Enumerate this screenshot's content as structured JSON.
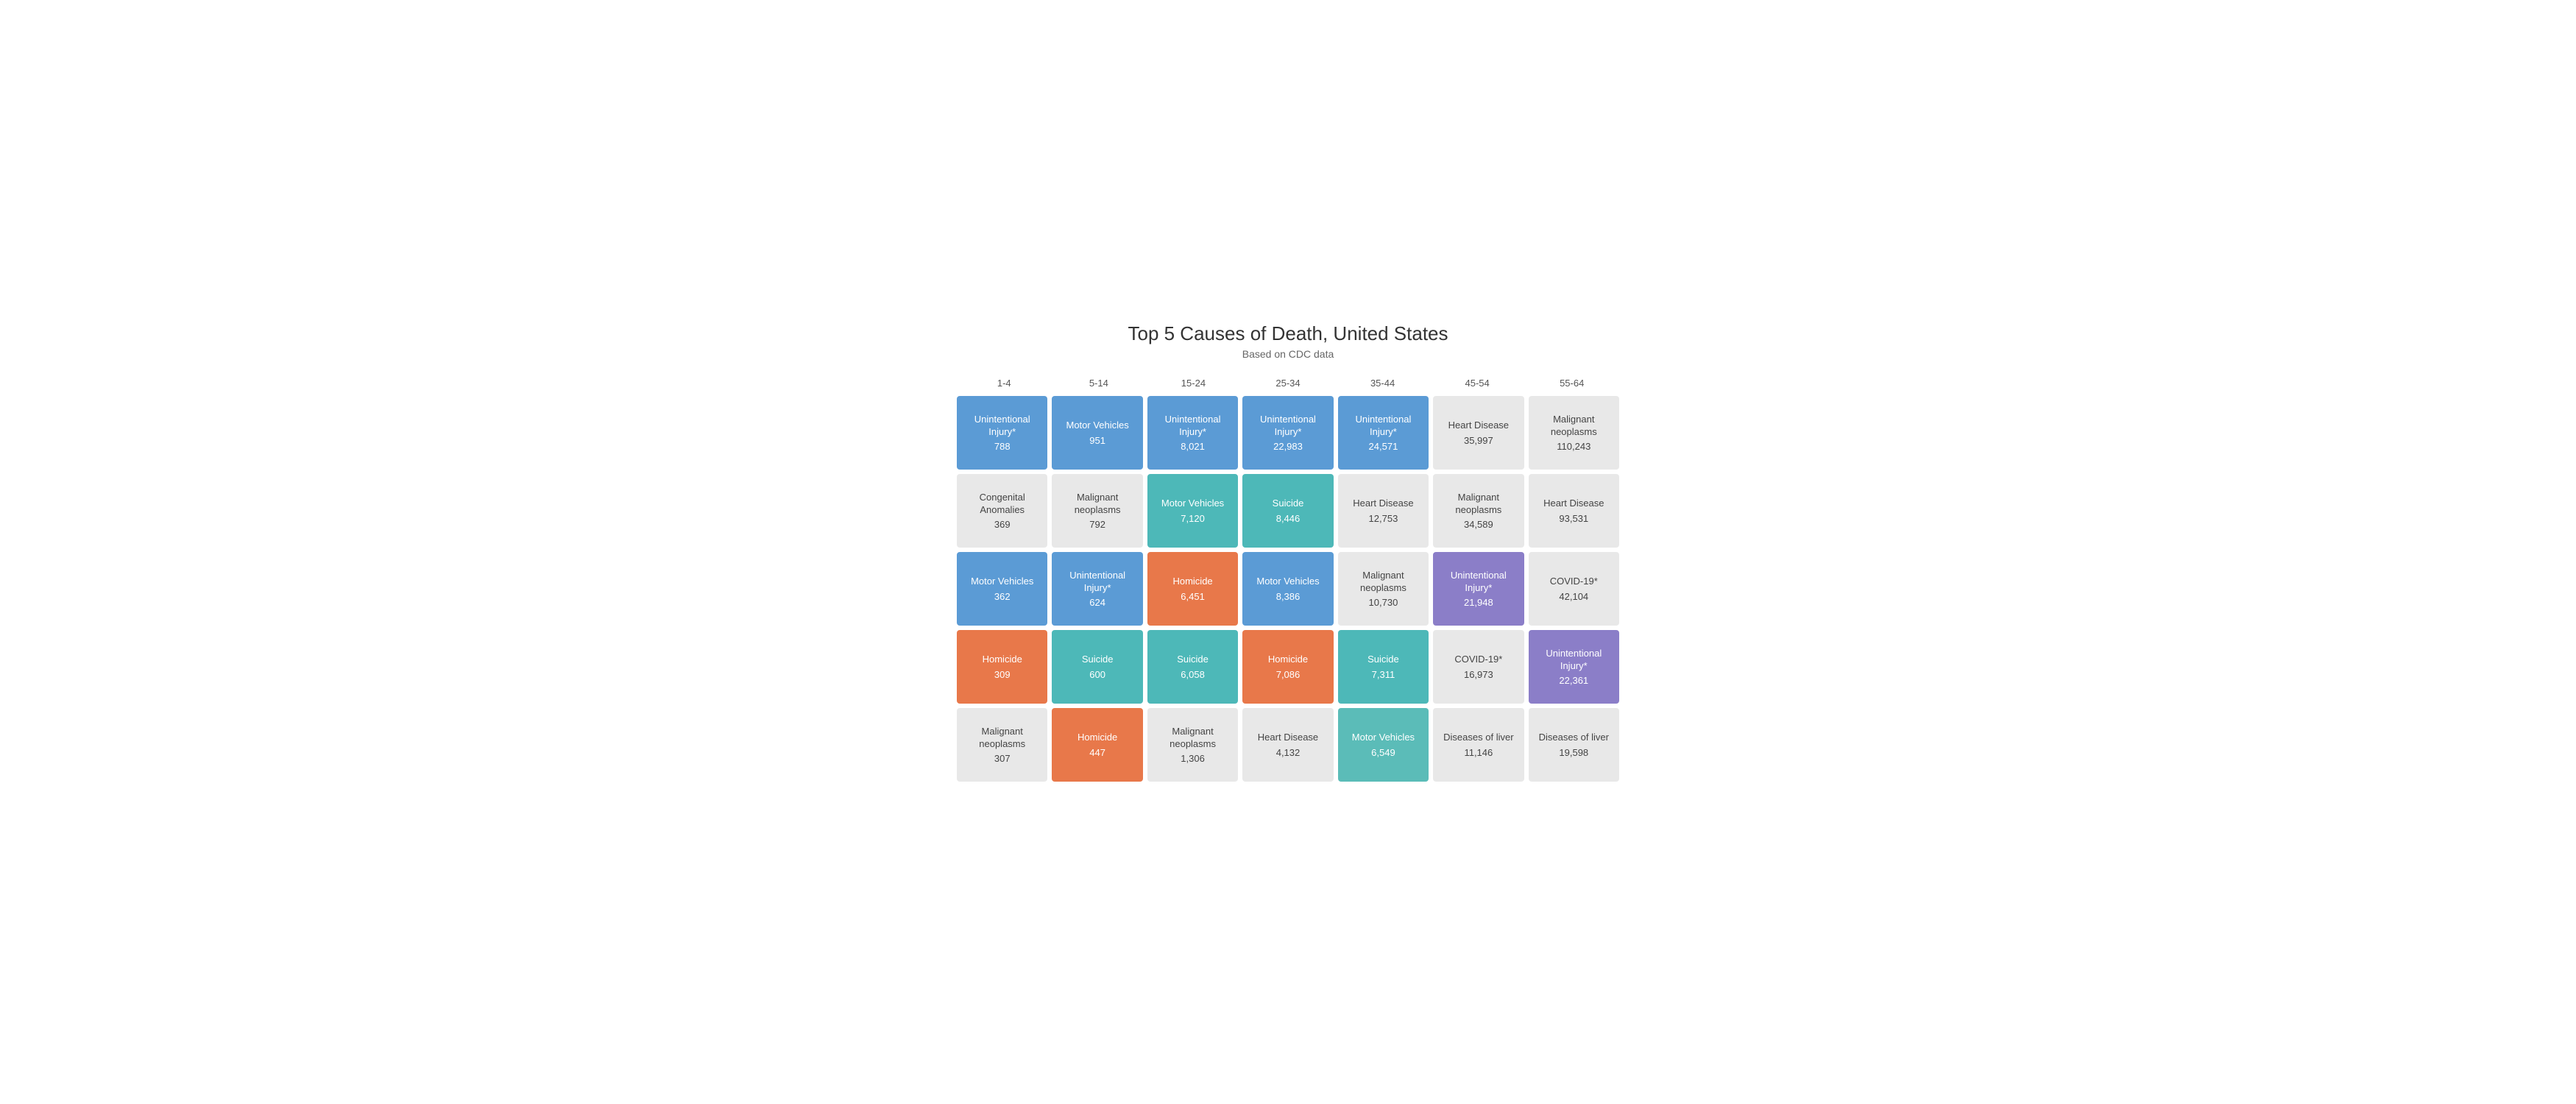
{
  "title": "Top 5 Causes of Death, United States",
  "subtitle": "Based on CDC data",
  "age_groups": [
    "1-4",
    "5-14",
    "15-24",
    "25-34",
    "35-44",
    "45-54",
    "55-64"
  ],
  "rows": [
    [
      {
        "label": "Unintentional Injury*",
        "value": "788",
        "color": "color-blue"
      },
      {
        "label": "Motor Vehicles",
        "value": "951",
        "color": "color-blue"
      },
      {
        "label": "Unintentional Injury*",
        "value": "8,021",
        "color": "color-blue"
      },
      {
        "label": "Unintentional Injury*",
        "value": "22,983",
        "color": "color-blue"
      },
      {
        "label": "Unintentional Injury*",
        "value": "24,571",
        "color": "color-blue"
      },
      {
        "label": "Heart Disease",
        "value": "35,997",
        "color": "color-gray"
      },
      {
        "label": "Malignant neoplasms",
        "value": "110,243",
        "color": "color-gray"
      }
    ],
    [
      {
        "label": "Congenital Anomalies",
        "value": "369",
        "color": "color-gray"
      },
      {
        "label": "Malignant neoplasms",
        "value": "792",
        "color": "color-gray"
      },
      {
        "label": "Motor Vehicles",
        "value": "7,120",
        "color": "color-teal"
      },
      {
        "label": "Suicide",
        "value": "8,446",
        "color": "color-teal"
      },
      {
        "label": "Heart Disease",
        "value": "12,753",
        "color": "color-gray"
      },
      {
        "label": "Malignant neoplasms",
        "value": "34,589",
        "color": "color-gray"
      },
      {
        "label": "Heart Disease",
        "value": "93,531",
        "color": "color-gray"
      }
    ],
    [
      {
        "label": "Motor Vehicles",
        "value": "362",
        "color": "color-blue"
      },
      {
        "label": "Unintentional Injury*",
        "value": "624",
        "color": "color-blue"
      },
      {
        "label": "Homicide",
        "value": "6,451",
        "color": "color-orange"
      },
      {
        "label": "Motor Vehicles",
        "value": "8,386",
        "color": "color-blue"
      },
      {
        "label": "Malignant neoplasms",
        "value": "10,730",
        "color": "color-gray"
      },
      {
        "label": "Unintentional Injury*",
        "value": "21,948",
        "color": "color-purple"
      },
      {
        "label": "COVID-19*",
        "value": "42,104",
        "color": "color-gray"
      }
    ],
    [
      {
        "label": "Homicide",
        "value": "309",
        "color": "color-orange"
      },
      {
        "label": "Suicide",
        "value": "600",
        "color": "color-teal"
      },
      {
        "label": "Suicide",
        "value": "6,058",
        "color": "color-teal"
      },
      {
        "label": "Homicide",
        "value": "7,086",
        "color": "color-orange"
      },
      {
        "label": "Suicide",
        "value": "7,311",
        "color": "color-teal"
      },
      {
        "label": "COVID-19*",
        "value": "16,973",
        "color": "color-gray"
      },
      {
        "label": "Unintentional Injury*",
        "value": "22,361",
        "color": "color-purple"
      }
    ],
    [
      {
        "label": "Malignant neoplasms",
        "value": "307",
        "color": "color-gray"
      },
      {
        "label": "Homicide",
        "value": "447",
        "color": "color-orange"
      },
      {
        "label": "Malignant neoplasms",
        "value": "1,306",
        "color": "color-gray"
      },
      {
        "label": "Heart Disease",
        "value": "4,132",
        "color": "color-gray"
      },
      {
        "label": "Motor Vehicles",
        "value": "6,549",
        "color": "color-light-teal"
      },
      {
        "label": "Diseases of liver",
        "value": "11,146",
        "color": "color-gray"
      },
      {
        "label": "Diseases of liver",
        "value": "19,598",
        "color": "color-gray"
      }
    ]
  ]
}
